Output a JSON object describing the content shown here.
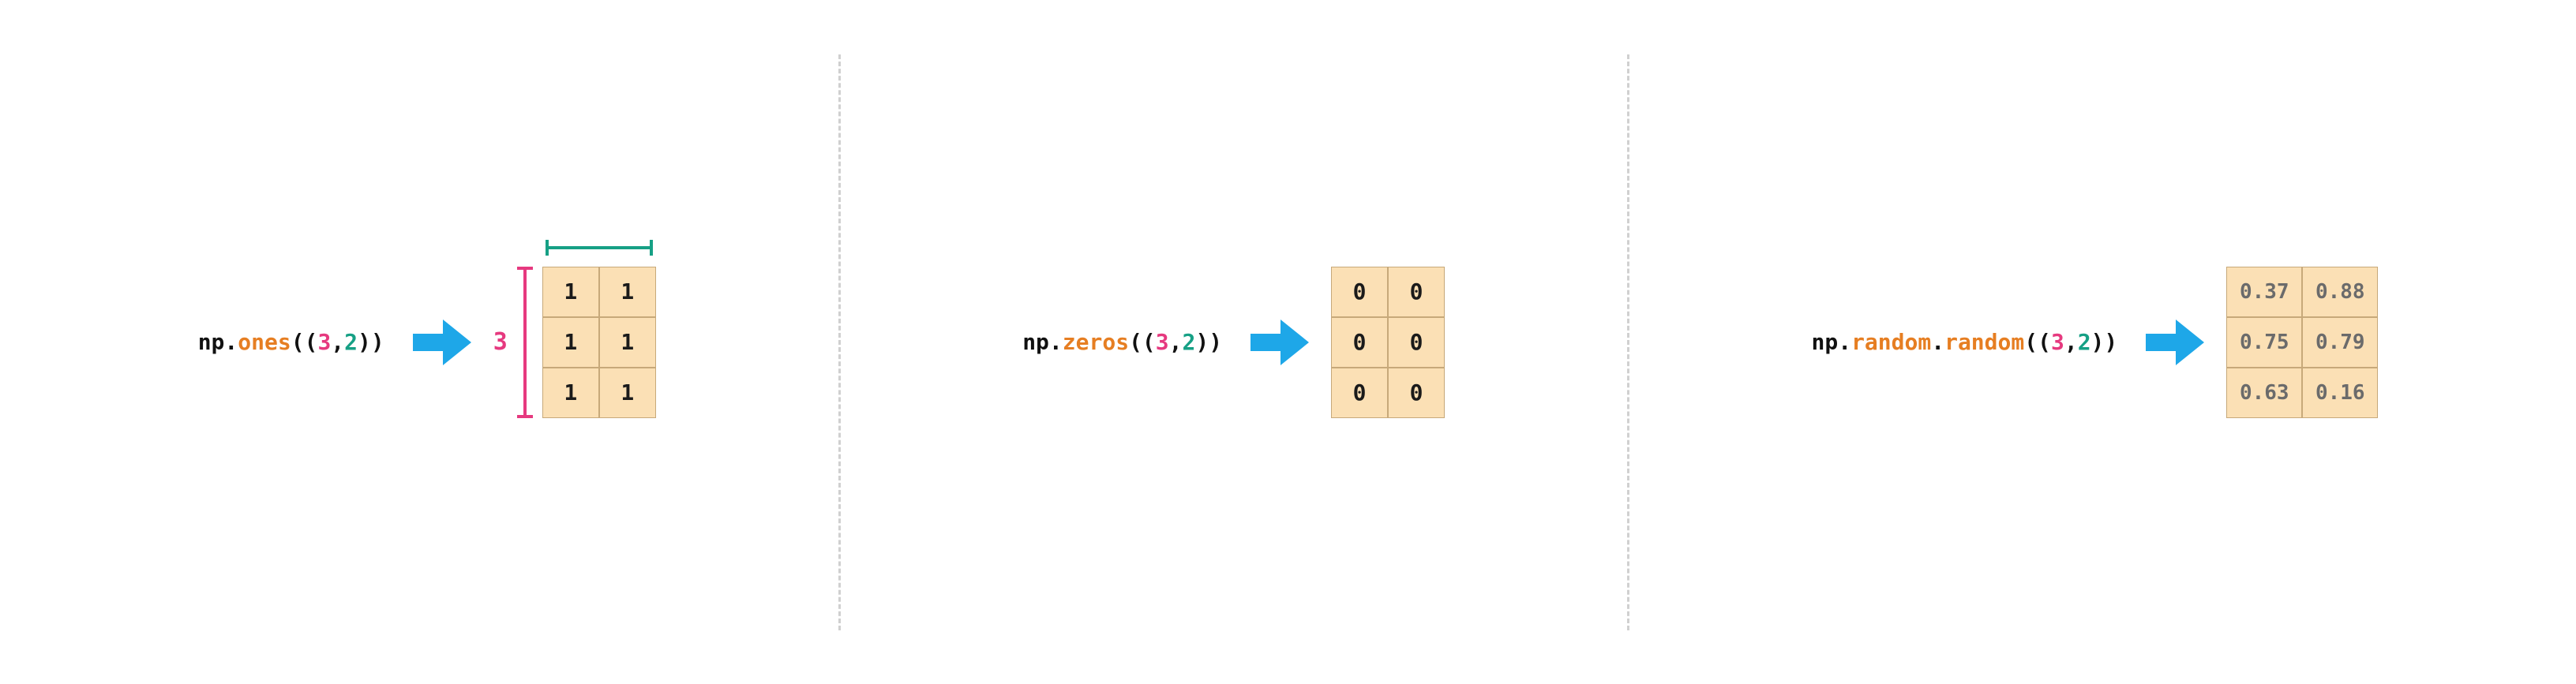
{
  "panels": {
    "ones": {
      "code": {
        "np": "np",
        "fn": "ones",
        "n1": "3",
        "n2": "2"
      },
      "dim_left_label": "3",
      "matrix": [
        [
          "1",
          "1"
        ],
        [
          "1",
          "1"
        ],
        [
          "1",
          "1"
        ]
      ],
      "show_brackets": true
    },
    "zeros": {
      "code": {
        "np": "np",
        "fn": "zeros",
        "n1": "3",
        "n2": "2"
      },
      "matrix": [
        [
          "0",
          "0"
        ],
        [
          "0",
          "0"
        ],
        [
          "0",
          "0"
        ]
      ],
      "show_brackets": false
    },
    "random": {
      "code": {
        "np": "np",
        "fn_a": "random",
        "fn_b": "random",
        "n1": "3",
        "n2": "2"
      },
      "matrix": [
        [
          "0.37",
          "0.88"
        ],
        [
          "0.75",
          "0.79"
        ],
        [
          "0.63",
          "0.16"
        ]
      ],
      "show_brackets": false,
      "float_cells": true
    }
  },
  "colors": {
    "fn": "#e67e22",
    "dim_rows": "#e6397f",
    "dim_cols": "#16a085",
    "arrow": "#1ea7e8",
    "cell_fill": "#fbe0b5",
    "cell_border": "#c7a97a"
  }
}
